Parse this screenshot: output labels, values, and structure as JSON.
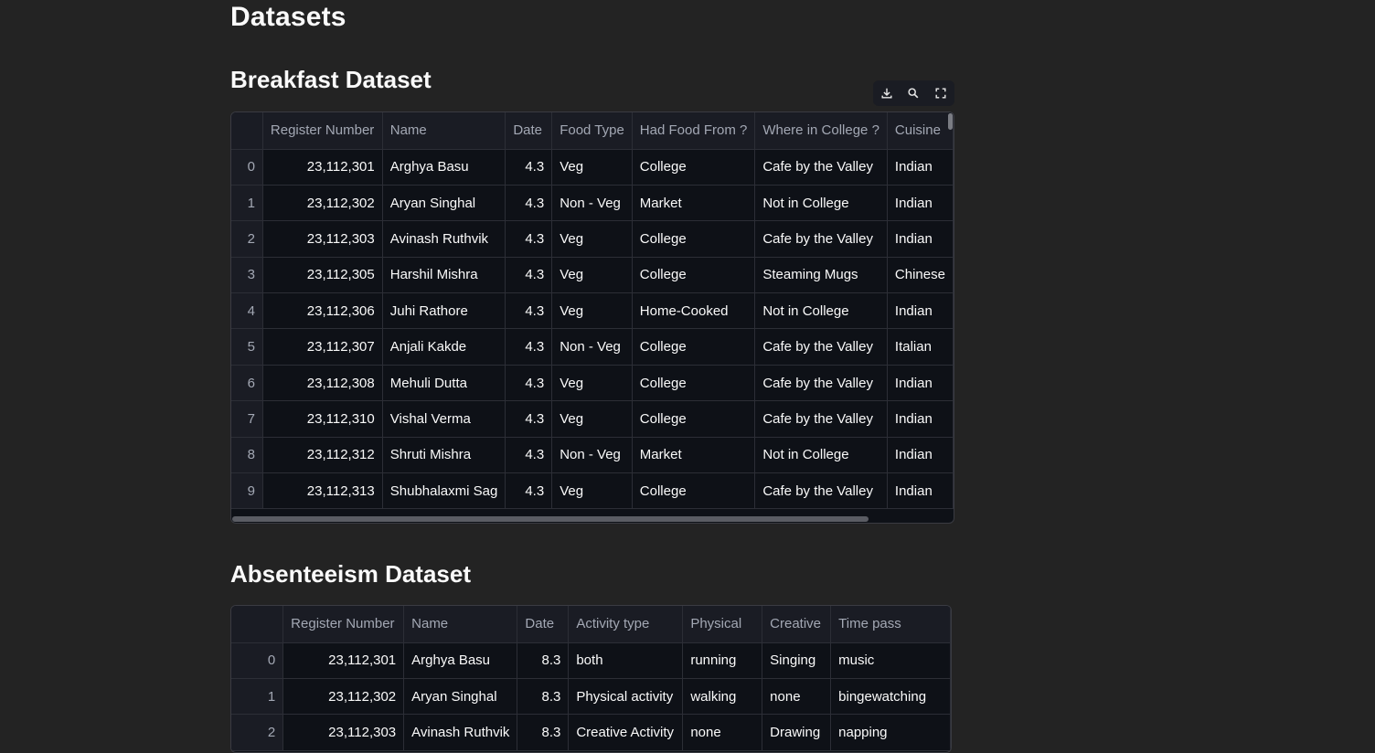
{
  "page": {
    "title": "Datasets"
  },
  "breakfast": {
    "title": "Breakfast Dataset",
    "toolbar": {
      "download_icon": "download-icon",
      "search_icon": "search-icon",
      "fullscreen_icon": "fullscreen-icon"
    },
    "columns": [
      "Register Number",
      "Name",
      "Date",
      "Food Type",
      "Had Food From ?",
      "Where in College ?",
      "Cuisine"
    ],
    "rows": [
      [
        "0",
        "23,112,301",
        "Arghya Basu",
        "4.3",
        "Veg",
        "College",
        "Cafe by the Valley",
        "Indian"
      ],
      [
        "1",
        "23,112,302",
        "Aryan Singhal",
        "4.3",
        "Non - Veg",
        "Market",
        "Not in College",
        "Indian"
      ],
      [
        "2",
        "23,112,303",
        "Avinash Ruthvik",
        "4.3",
        "Veg",
        "College",
        "Cafe by the Valley",
        "Indian"
      ],
      [
        "3",
        "23,112,305",
        "Harshil Mishra",
        "4.3",
        "Veg",
        "College",
        "Steaming Mugs",
        "Chinese"
      ],
      [
        "4",
        "23,112,306",
        "Juhi Rathore",
        "4.3",
        "Veg",
        "Home-Cooked",
        "Not in College",
        "Indian"
      ],
      [
        "5",
        "23,112,307",
        "Anjali Kakde",
        "4.3",
        "Non - Veg",
        "College",
        "Cafe by the Valley",
        "Italian"
      ],
      [
        "6",
        "23,112,308",
        "Mehuli Dutta",
        "4.3",
        "Veg",
        "College",
        "Cafe by the Valley",
        "Indian"
      ],
      [
        "7",
        "23,112,310",
        "Vishal Verma",
        "4.3",
        "Veg",
        "College",
        "Cafe by the Valley",
        "Indian"
      ],
      [
        "8",
        "23,112,312",
        "Shruti Mishra",
        "4.3",
        "Non - Veg",
        "Market",
        "Not in College",
        "Indian"
      ],
      [
        "9",
        "23,112,313",
        "Shubhalaxmi Sag",
        "4.3",
        "Veg",
        "College",
        "Cafe by the Valley",
        "Indian"
      ]
    ]
  },
  "absenteeism": {
    "title": "Absenteeism Dataset",
    "columns": [
      "Register Number",
      "Name",
      "Date",
      "Activity type",
      "Physical",
      "Creative",
      "Time pass"
    ],
    "rows": [
      [
        "0",
        "23,112,301",
        "Arghya Basu",
        "8.3",
        "both",
        "running",
        "Singing",
        "music"
      ],
      [
        "1",
        "23,112,302",
        "Aryan Singhal",
        "8.3",
        "Physical activity",
        "walking",
        "none",
        "bingewatching"
      ],
      [
        "2",
        "23,112,303",
        "Avinash Ruthvik",
        "8.3",
        "Creative Activity",
        "none",
        "Drawing",
        "napping"
      ]
    ]
  }
}
